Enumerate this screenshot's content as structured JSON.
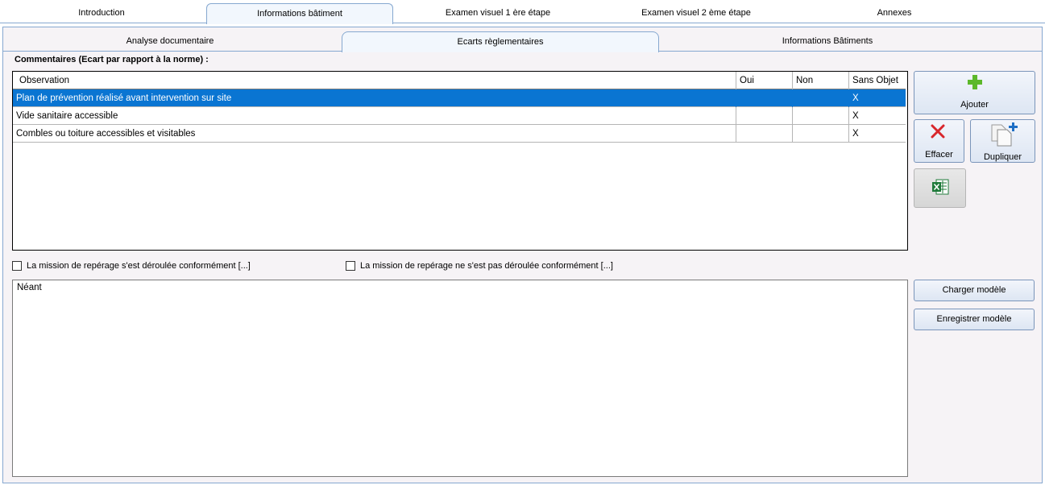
{
  "top_tabs": [
    "Introduction",
    "Informations bâtiment",
    "Examen visuel 1 ère étape",
    "Examen visuel 2 ème étape",
    "Annexes"
  ],
  "sub_tabs": [
    "Analyse documentaire",
    "Ecarts règlementaires",
    "Informations Bâtiments"
  ],
  "section_title": "Commentaires (Ecart par rapport à la norme) :",
  "table": {
    "columns": [
      "Observation",
      "Oui",
      "Non",
      "Sans Objet"
    ],
    "rows": [
      [
        "Plan de prévention réalisé avant intervention sur site",
        "",
        "",
        "X"
      ],
      [
        "Vide sanitaire accessible",
        "",
        "",
        "X"
      ],
      [
        "Combles ou toiture accessibles et visitables",
        "",
        "",
        "X"
      ]
    ],
    "selected_row": 0
  },
  "buttons": {
    "ajouter": "Ajouter",
    "effacer": "Effacer",
    "dupliquer": "Dupliquer",
    "charger": "Charger modèle",
    "enregistrer": "Enregistrer modèle"
  },
  "checkboxes": {
    "conforme": "La mission de repérage s'est déroulée conformément [...]",
    "non_conforme": "La mission de repérage ne s'est pas déroulée conformément [...]"
  },
  "memo_text": "Néant",
  "colors": {
    "selection": "#0a75d2",
    "accent_green": "#5cb82a",
    "delete_red": "#d8262b",
    "tab_border": "#86a8d0"
  }
}
